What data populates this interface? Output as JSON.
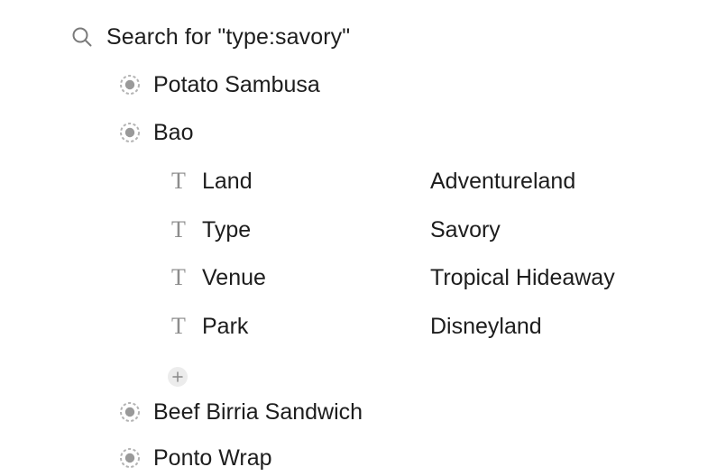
{
  "search": {
    "icon": "search-icon",
    "label": "Search for \"type:savory\""
  },
  "results": [
    {
      "label": "Potato Sambusa",
      "icon": "node-bullet-icon"
    },
    {
      "label": "Bao",
      "icon": "node-bullet-icon",
      "fields": [
        {
          "icon": "text-field-icon",
          "glyph": "T",
          "name": "Land",
          "value": "Adventureland"
        },
        {
          "icon": "text-field-icon",
          "glyph": "T",
          "name": "Type",
          "value": "Savory"
        },
        {
          "icon": "text-field-icon",
          "glyph": "T",
          "name": "Venue",
          "value": "Tropical Hideaway"
        },
        {
          "icon": "text-field-icon",
          "glyph": "T",
          "name": "Park",
          "value": "Disneyland"
        }
      ],
      "add_field_icon": "plus-icon"
    },
    {
      "label": "Beef Birria Sandwich",
      "icon": "node-bullet-icon"
    },
    {
      "label": "Ponto Wrap",
      "icon": "node-bullet-icon"
    }
  ],
  "colors": {
    "text": "#1d1d1d",
    "icon_gray": "#8c8c8c",
    "bullet_fill": "#9a9a9a",
    "add_bg": "#ececec"
  }
}
